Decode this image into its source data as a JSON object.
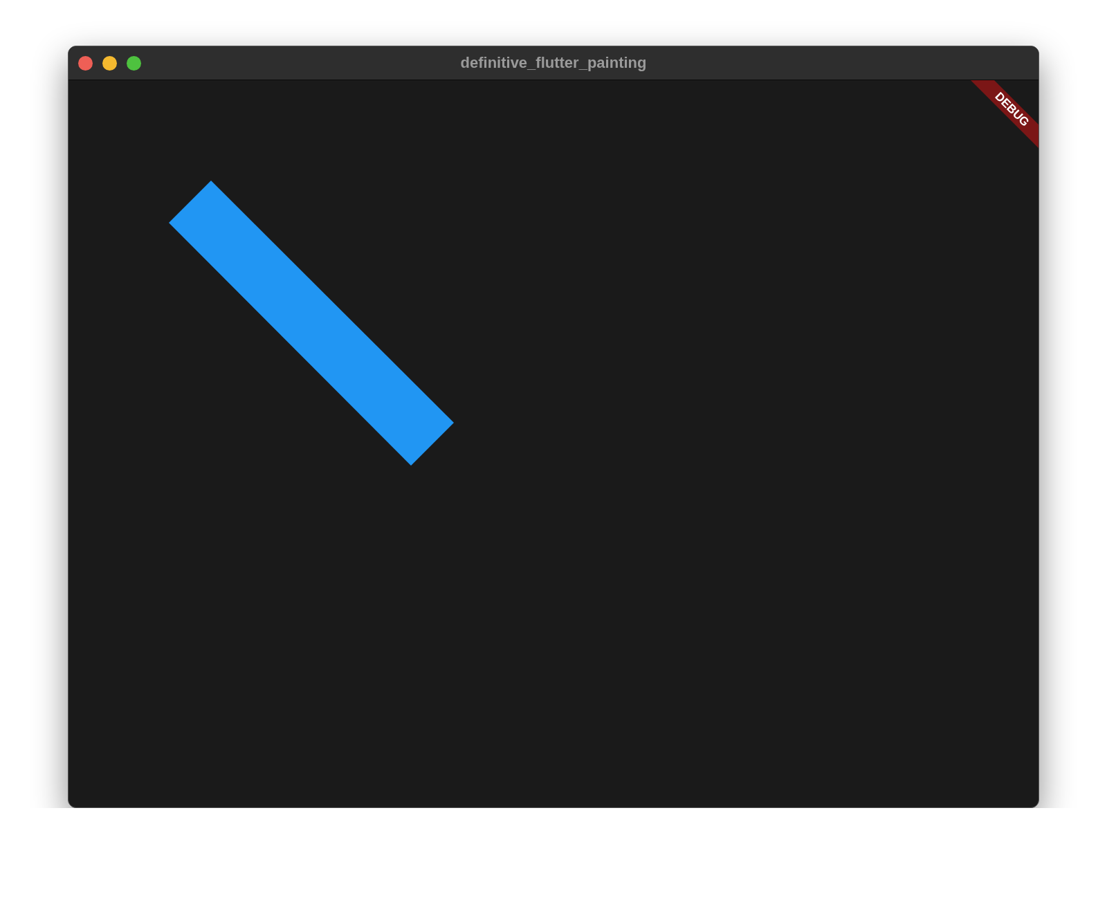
{
  "window": {
    "title": "definitive_flutter_painting"
  },
  "debug_banner": {
    "label": "DEBUG"
  }
}
